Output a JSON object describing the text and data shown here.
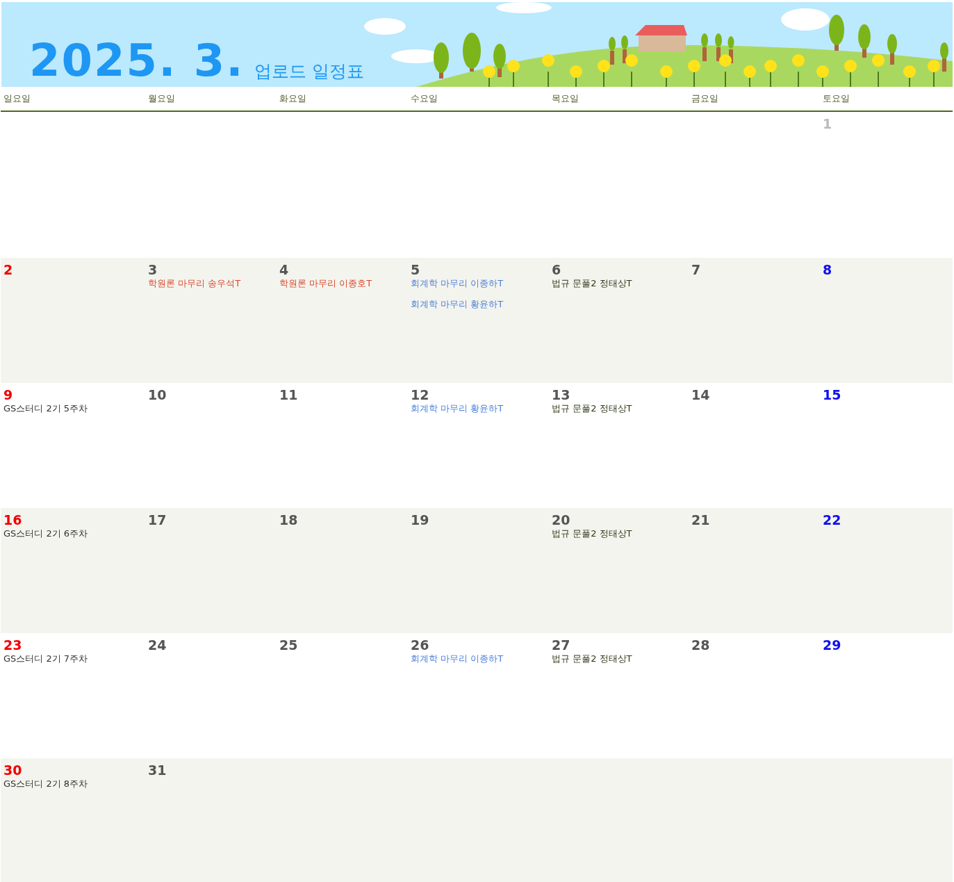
{
  "banner": {
    "title": "2025. 3.",
    "subtitle": "업로드 일정표"
  },
  "weekdays": [
    "일요일",
    "월요일",
    "화요일",
    "수요일",
    "목요일",
    "금요일",
    "토요일"
  ],
  "weeks": [
    [
      {
        "day": "1",
        "kind": "muted"
      }
    ],
    [
      {
        "day": "2",
        "kind": "sunday"
      },
      {
        "day": "3",
        "kind": "weekday",
        "events": [
          {
            "text": "학원론 마무리 송우석T",
            "color": "#d9472b"
          }
        ]
      },
      {
        "day": "4",
        "kind": "weekday",
        "events": [
          {
            "text": "학원론 마무리 이종호T",
            "color": "#d9472b"
          }
        ]
      },
      {
        "day": "5",
        "kind": "weekday",
        "events": [
          {
            "text": "회계학 마무리 이종하T",
            "color": "#4a7fd8"
          },
          {
            "text": "회계학 마무리 황윤하T",
            "color": "#4a7fd8"
          }
        ]
      },
      {
        "day": "6",
        "kind": "weekday",
        "events": [
          {
            "text": "법규 문풀2 정태상T",
            "color": "#2f3a1a"
          }
        ]
      },
      {
        "day": "7",
        "kind": "weekday"
      },
      {
        "day": "8",
        "kind": "saturday"
      }
    ],
    [
      {
        "day": "9",
        "kind": "sunday",
        "events": [
          {
            "text": "GS스터디 2기 5주차",
            "color": "#333333"
          }
        ]
      },
      {
        "day": "10",
        "kind": "weekday"
      },
      {
        "day": "11",
        "kind": "weekday"
      },
      {
        "day": "12",
        "kind": "weekday",
        "events": [
          {
            "text": "회계학 마무리 황윤하T",
            "color": "#4a7fd8"
          }
        ]
      },
      {
        "day": "13",
        "kind": "weekday",
        "events": [
          {
            "text": "법규 문풀2 정태상T",
            "color": "#2f3a1a"
          }
        ]
      },
      {
        "day": "14",
        "kind": "weekday"
      },
      {
        "day": "15",
        "kind": "saturday"
      }
    ],
    [
      {
        "day": "16",
        "kind": "sunday",
        "events": [
          {
            "text": "GS스터디 2기 6주차",
            "color": "#333333"
          }
        ]
      },
      {
        "day": "17",
        "kind": "weekday"
      },
      {
        "day": "18",
        "kind": "weekday"
      },
      {
        "day": "19",
        "kind": "weekday"
      },
      {
        "day": "20",
        "kind": "weekday",
        "events": [
          {
            "text": "법규 문풀2 정태상T",
            "color": "#2f3a1a"
          }
        ]
      },
      {
        "day": "21",
        "kind": "weekday"
      },
      {
        "day": "22",
        "kind": "saturday"
      }
    ],
    [
      {
        "day": "23",
        "kind": "sunday",
        "events": [
          {
            "text": "GS스터디 2기 7주차",
            "color": "#333333"
          }
        ]
      },
      {
        "day": "24",
        "kind": "weekday"
      },
      {
        "day": "25",
        "kind": "weekday"
      },
      {
        "day": "26",
        "kind": "weekday",
        "events": [
          {
            "text": "회계학 마무리 이종하T",
            "color": "#4a7fd8"
          }
        ]
      },
      {
        "day": "27",
        "kind": "weekday",
        "events": [
          {
            "text": "법규 문풀2 정태상T",
            "color": "#2f3a1a"
          }
        ]
      },
      {
        "day": "28",
        "kind": "weekday"
      },
      {
        "day": "29",
        "kind": "saturday"
      }
    ],
    [
      {
        "day": "30",
        "kind": "sunday",
        "events": [
          {
            "text": "GS스터디 2기 8주차",
            "color": "#333333"
          }
        ]
      },
      {
        "day": "31",
        "kind": "weekday"
      }
    ]
  ]
}
